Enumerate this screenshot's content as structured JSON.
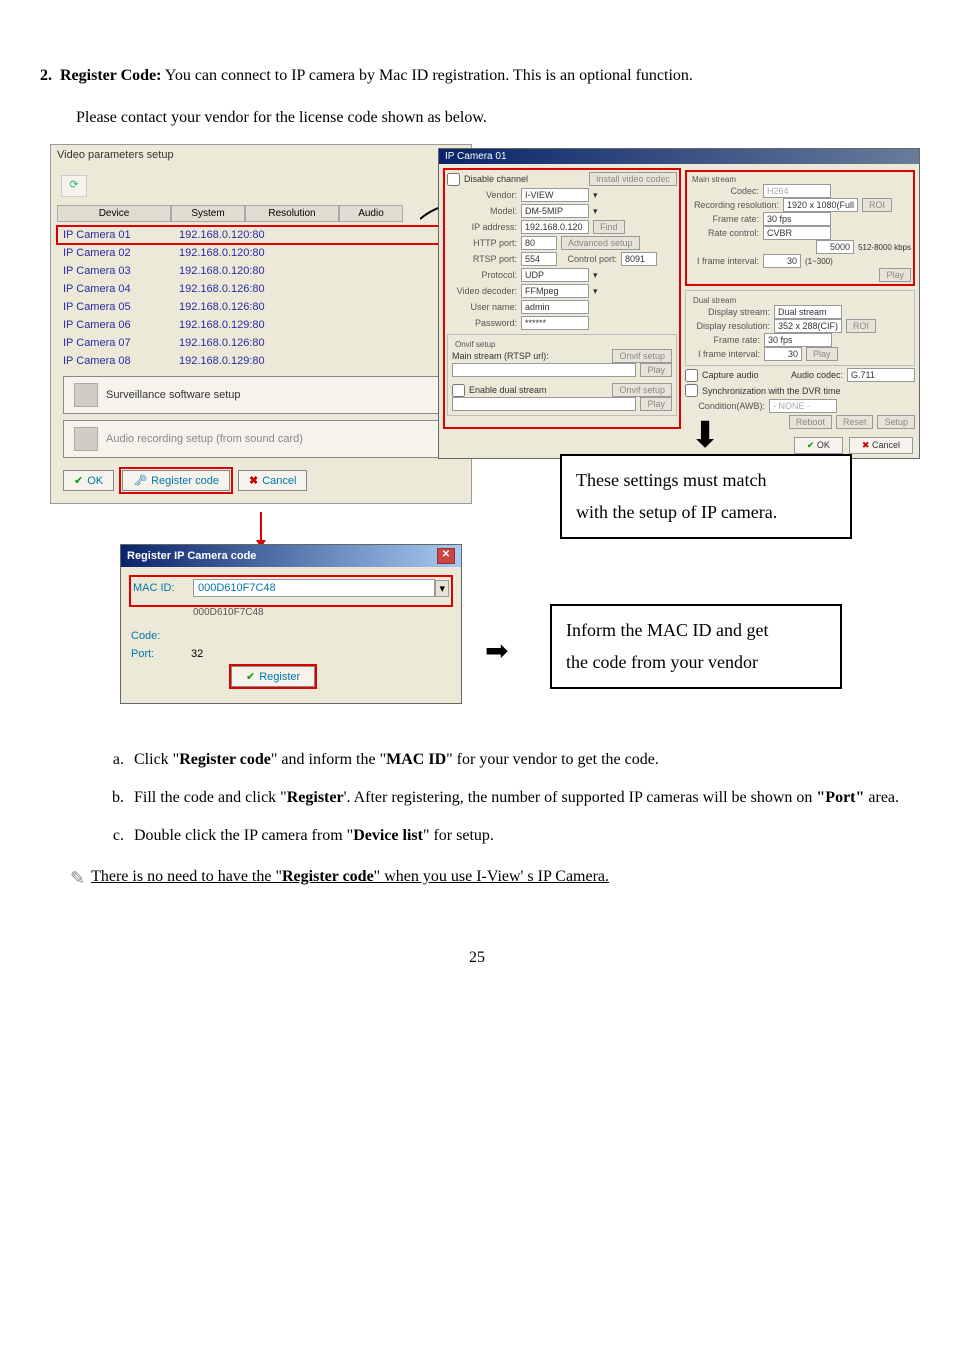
{
  "section": {
    "num": "2.",
    "title": "Register Code:",
    "desc": " You can connect to IP camera by Mac ID registration. This is an optional function.",
    "desc2": "Please contact your vendor for the license code shown as below."
  },
  "vp": {
    "title": "Video parameters setup",
    "headers": {
      "device": "Device",
      "system": "System",
      "res": "Resolution",
      "audio": "Audio"
    },
    "rows": [
      {
        "name": "IP Camera 01",
        "addr": "192.168.0.120:80"
      },
      {
        "name": "IP Camera 02",
        "addr": "192.168.0.120:80"
      },
      {
        "name": "IP Camera 03",
        "addr": "192.168.0.120:80"
      },
      {
        "name": "IP Camera 04",
        "addr": "192.168.0.126:80"
      },
      {
        "name": "IP Camera 05",
        "addr": "192.168.0.126:80"
      },
      {
        "name": "IP Camera 06",
        "addr": "192.168.0.129:80"
      },
      {
        "name": "IP Camera 07",
        "addr": "192.168.0.126:80"
      },
      {
        "name": "IP Camera 08",
        "addr": "192.168.0.129:80"
      }
    ],
    "surv_btn": "Surveillance software setup",
    "audio_btn": "Audio recording setup (from sound card)",
    "ok": "OK",
    "register": "Register code",
    "cancel": "Cancel"
  },
  "reg": {
    "title": "Register IP Camera code",
    "macid_lbl": "MAC ID:",
    "macid_val": "000D610F7C48",
    "macid_below": "000D610F7C48",
    "code_lbl": "Code:",
    "code_val": "",
    "port_lbl": "Port:",
    "port_val": "32",
    "register_btn": "Register"
  },
  "ipc": {
    "title": "IP Camera 01",
    "disable": "Disable channel",
    "install": "Install video codec",
    "vendor_lbl": "Vendor:",
    "vendor_val": "I-VIEW",
    "model_lbl": "Model:",
    "model_val": "DM-5MIP",
    "ip_lbl": "IP address:",
    "ip_val": "192.168.0.120",
    "find": "Find",
    "http_lbl": "HTTP port:",
    "http_val": "80",
    "adv": "Advanced setup",
    "rtsp_lbl": "RTSP port:",
    "rtsp_val": "554",
    "ctrl_lbl": "Control port:",
    "ctrl_val": "8091",
    "proto_lbl": "Protocol:",
    "proto_val": "UDP",
    "vdec_lbl": "Video decoder:",
    "vdec_val": "FFMpeg",
    "user_lbl": "User name:",
    "user_val": "admin",
    "pass_lbl": "Password:",
    "pass_val": "******",
    "onvif_title": "Onvif setup",
    "mainstream_lbl": "Main stream (RTSP url):",
    "onvif_btn": "Onvif setup",
    "play_btn": "Play",
    "enable_dual": "Enable dual stream",
    "main_fs": "Main stream",
    "codec_lbl": "Codec:",
    "codec_val": "H264",
    "recres_lbl": "Recording resolution:",
    "recres_val": "1920 x 1080(Full",
    "roi": "ROI",
    "fps_lbl": "Frame rate:",
    "fps_val": "30 fps",
    "rate_lbl": "Rate control:",
    "rate_val": "CVBR",
    "kbps": "5000",
    "kbps_range": "512-8000 kbps",
    "ifr_lbl": "I frame interval:",
    "ifr_val": "30",
    "ifr_range": "(1~300)",
    "dual_fs": "Dual stream",
    "disp_lbl": "Display stream:",
    "disp_val": "Dual stream",
    "dispres_lbl": "Display resolution:",
    "dispres_val": "352 x 288(CIF)",
    "cap_audio": "Capture audio",
    "audio_codec_lbl": "Audio codec:",
    "audio_codec_val": "G.711",
    "sync": "Synchronization with the DVR time",
    "cond_lbl": "Condition(AWB):",
    "cond_val": "- NONE -",
    "reboot": "Reboot",
    "reset": "Reset",
    "setup": "Setup",
    "ok": "OK",
    "cancel": "Cancel"
  },
  "annot": {
    "a1a": "These settings must match",
    "a1b": "with the setup of IP camera.",
    "a2a": "Inform the MAC ID and get",
    "a2b": "the code from your vendor"
  },
  "letters": {
    "a": [
      "Click \"",
      "Register code",
      "\" and inform the \"",
      "MAC ID",
      "\" for your vendor to get the code."
    ],
    "b": [
      "Fill the code and click \"",
      "Register",
      "'. After registering, the number of supported IP cameras will be shown on ",
      "\"Port\"",
      " area."
    ],
    "c": [
      "Double click the IP camera from \"",
      "Device list",
      "\" for setup."
    ]
  },
  "note": [
    "There is no need to have the \"",
    "Register code",
    "\" when you use I-View' s IP Camera."
  ],
  "page": "25"
}
